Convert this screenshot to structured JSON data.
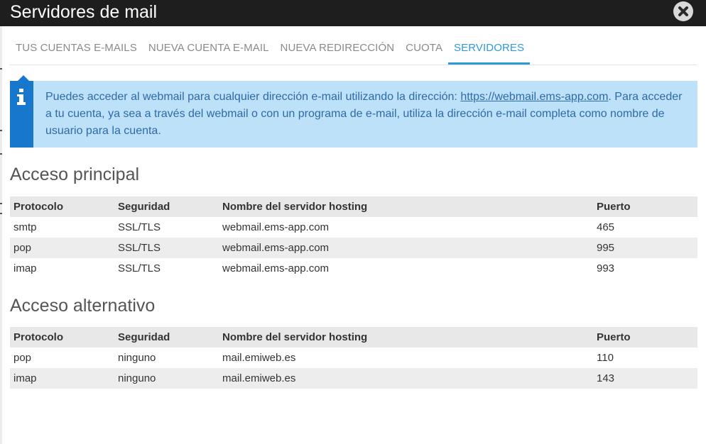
{
  "window": {
    "title": "Servidores de mail"
  },
  "tabs": [
    {
      "label": "TUS CUENTAS E-MAILS"
    },
    {
      "label": "NUEVA CUENTA E-MAIL"
    },
    {
      "label": "NUEVA REDIRECCIÓN"
    },
    {
      "label": "CUOTA"
    },
    {
      "label": "SERVIDORES"
    }
  ],
  "active_tab": "SERVIDORES",
  "info": {
    "text_before": "Puedes acceder al webmail para cualquier dirección e-mail utilizando la dirección: ",
    "link": "https://webmail.ems-app.com",
    "text_after": ". Para acceder a tu cuenta, ya sea a través del webmail o con un programa de e-mail, utiliza la dirección e-mail completa como nombre de usuario para la cuenta."
  },
  "principal": {
    "title": "Acceso principal",
    "headers": [
      "Protocolo",
      "Seguridad",
      "Nombre del servidor hosting",
      "Puerto"
    ],
    "rows": [
      [
        "smtp",
        "SSL/TLS",
        "webmail.ems-app.com",
        "465"
      ],
      [
        "pop",
        "SSL/TLS",
        "webmail.ems-app.com",
        "995"
      ],
      [
        "imap",
        "SSL/TLS",
        "webmail.ems-app.com",
        "993"
      ]
    ]
  },
  "alternativo": {
    "title": "Acceso alternativo",
    "headers": [
      "Protocolo",
      "Seguridad",
      "Nombre del servidor hosting",
      "Puerto"
    ],
    "rows": [
      [
        "pop",
        "ninguno",
        "mail.emiweb.es",
        "110"
      ],
      [
        "imap",
        "ninguno",
        "mail.emiweb.es",
        "143"
      ]
    ]
  },
  "colors": {
    "titlebar": "#1e1e1e",
    "accent": "#2e9ad8",
    "info_bg": "#bde1f8",
    "info_bar": "#1677cc"
  },
  "icons": {
    "close": "close-circle-icon",
    "info": "info-icon"
  }
}
